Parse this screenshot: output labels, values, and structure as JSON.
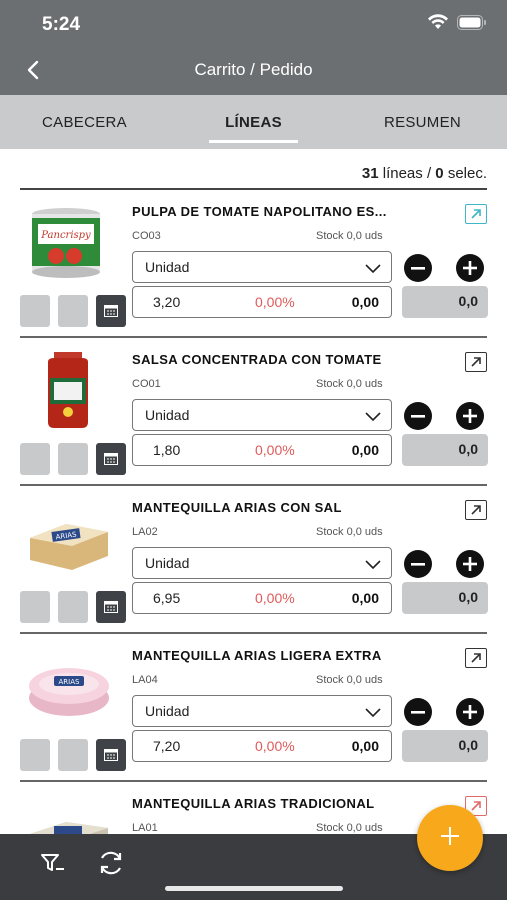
{
  "status": {
    "time": "5:24"
  },
  "nav": {
    "title": "Carrito / Pedido"
  },
  "tabs": [
    {
      "label": "CABECERA",
      "active": false
    },
    {
      "label": "LÍNEAS",
      "active": true
    },
    {
      "label": "RESUMEN",
      "active": false
    }
  ],
  "summary": {
    "lines_count": "31",
    "lines_label": "líneas /",
    "selected_count": "0",
    "selected_label": "selec."
  },
  "items": [
    {
      "name": "PULPA DE TOMATE NAPOLITANO ES...",
      "code": "CO03",
      "stock": "Stock 0,0 uds",
      "unit": "Unidad",
      "price": "3,20",
      "discount": "0,00%",
      "total": "0,00",
      "qty": "0,0",
      "ext_color": "teal",
      "image": "tomato-can"
    },
    {
      "name": "SALSA CONCENTRADA CON TOMATE",
      "code": "CO01",
      "stock": "Stock 0,0 uds",
      "unit": "Unidad",
      "price": "1,80",
      "discount": "0,00%",
      "total": "0,00",
      "qty": "0,0",
      "ext_color": "dark",
      "image": "sauce-jar"
    },
    {
      "name": "MANTEQUILLA ARIAS CON SAL",
      "code": "LA02",
      "stock": "Stock 0,0 uds",
      "unit": "Unidad",
      "price": "6,95",
      "discount": "0,00%",
      "total": "0,00",
      "qty": "0,0",
      "ext_color": "dark",
      "image": "butter-box"
    },
    {
      "name": "MANTEQUILLA ARIAS LIGERA EXTRA",
      "code": "LA04",
      "stock": "Stock 0,0 uds",
      "unit": "Unidad",
      "price": "7,20",
      "discount": "0,00%",
      "total": "0,00",
      "qty": "0,0",
      "ext_color": "dark",
      "image": "butter-tub"
    },
    {
      "name": "MANTEQUILLA ARIAS TRADICIONAL",
      "code": "LA01",
      "stock": "Stock 0,0 uds",
      "unit": "Unidad",
      "price": "",
      "discount": "",
      "total": "",
      "qty": "",
      "ext_color": "red",
      "image": "butter-box-2"
    }
  ],
  "fab": {
    "icon": "plus-icon"
  },
  "colors": {
    "header": "#6c6f72",
    "tabs": "#c9cacb",
    "fab": "#f7a81b",
    "discount": "#e05a5a",
    "bottom": "#3a3c3f"
  }
}
